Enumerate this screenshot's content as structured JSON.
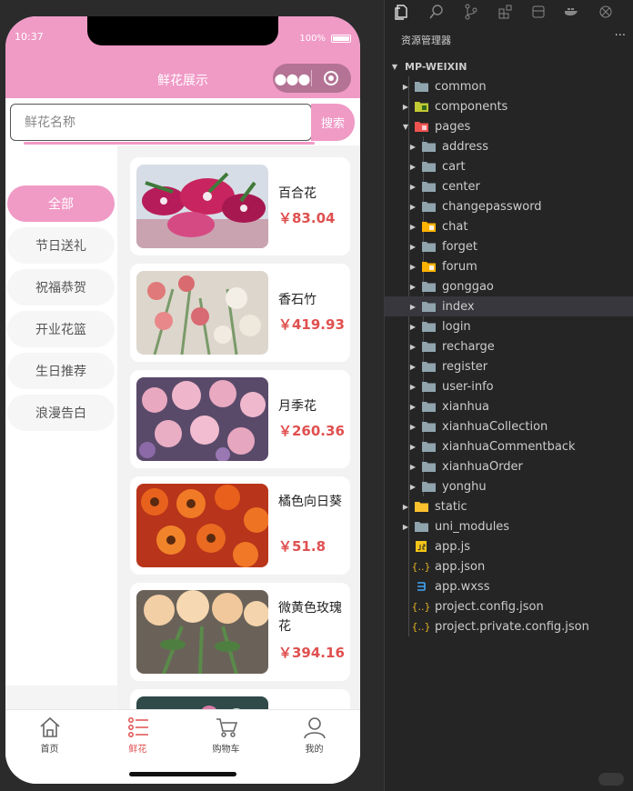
{
  "status": {
    "time": "10:37",
    "battery": "100%"
  },
  "nav": {
    "title": "鲜花展示"
  },
  "search": {
    "placeholder": "鲜花名称",
    "button": "搜索"
  },
  "categories": [
    "全部",
    "节日送礼",
    "祝福恭贺",
    "开业花篮",
    "生日推荐",
    "浪漫告白"
  ],
  "products": [
    {
      "name": "百合花",
      "price": "￥83.04"
    },
    {
      "name": "香石竹",
      "price": "￥419.93"
    },
    {
      "name": "月季花",
      "price": "￥260.36"
    },
    {
      "name": "橘色向日葵",
      "price": "￥51.8"
    },
    {
      "name": "微黄色玫瑰花",
      "price": "￥394.16"
    }
  ],
  "tabs": [
    "首页",
    "鲜花",
    "购物车",
    "我的"
  ],
  "explorer": {
    "title": "资源管理器",
    "root": "MP-WEIXIN",
    "items": [
      "common",
      "components",
      "pages",
      "address",
      "cart",
      "center",
      "changepassword",
      "chat",
      "forget",
      "forum",
      "gonggao",
      "index",
      "login",
      "recharge",
      "register",
      "user-info",
      "xianhua",
      "xianhuaCollection",
      "xianhuaCommentback",
      "xianhuaOrder",
      "yonghu",
      "static",
      "uni_modules",
      "app.js",
      "app.json",
      "app.wxss",
      "project.config.json",
      "project.private.config.json"
    ]
  },
  "colors": {
    "accent": "#f09ac6",
    "price": "#e05050",
    "editor_bg": "#252526"
  }
}
